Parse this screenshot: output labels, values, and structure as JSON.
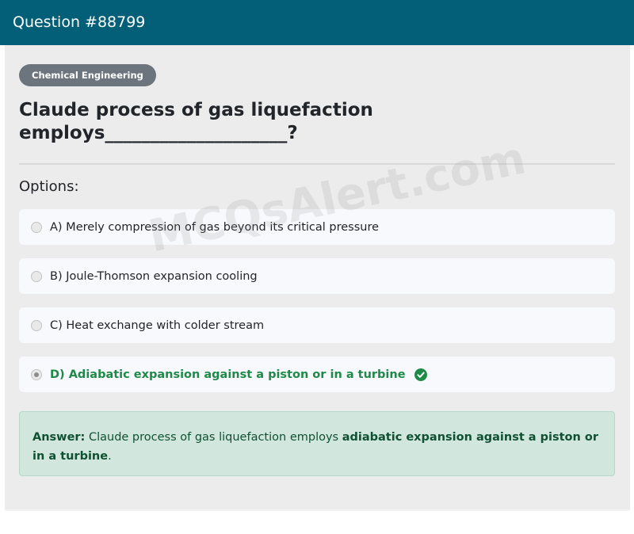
{
  "header": {
    "title": "Question #88799"
  },
  "category": "Chemical Engineering",
  "question": "Claude process of gas liquefaction employs____________________?",
  "options_label": "Options:",
  "options": [
    {
      "text": "A) Merely compression of gas beyond its critical pressure",
      "selected": false,
      "correct": false
    },
    {
      "text": "B) Joule-Thomson expansion cooling",
      "selected": false,
      "correct": false
    },
    {
      "text": "C) Heat exchange with colder stream",
      "selected": false,
      "correct": false
    },
    {
      "text": "D) Adiabatic expansion against a piston or in a turbine",
      "selected": true,
      "correct": true
    }
  ],
  "answer": {
    "label": "Answer:",
    "prefix": " Claude process of gas liquefaction employs ",
    "highlight": "adiabatic expansion against a piston or in a turbine",
    "suffix": "."
  },
  "watermark": "MCQsAlert.com",
  "colors": {
    "header_bg": "#035f78",
    "badge_bg": "#6c757d",
    "correct_green": "#1e8a47",
    "answer_bg": "#d1e6dd"
  },
  "icons": {
    "correct_indicator": "check-circle-icon"
  }
}
